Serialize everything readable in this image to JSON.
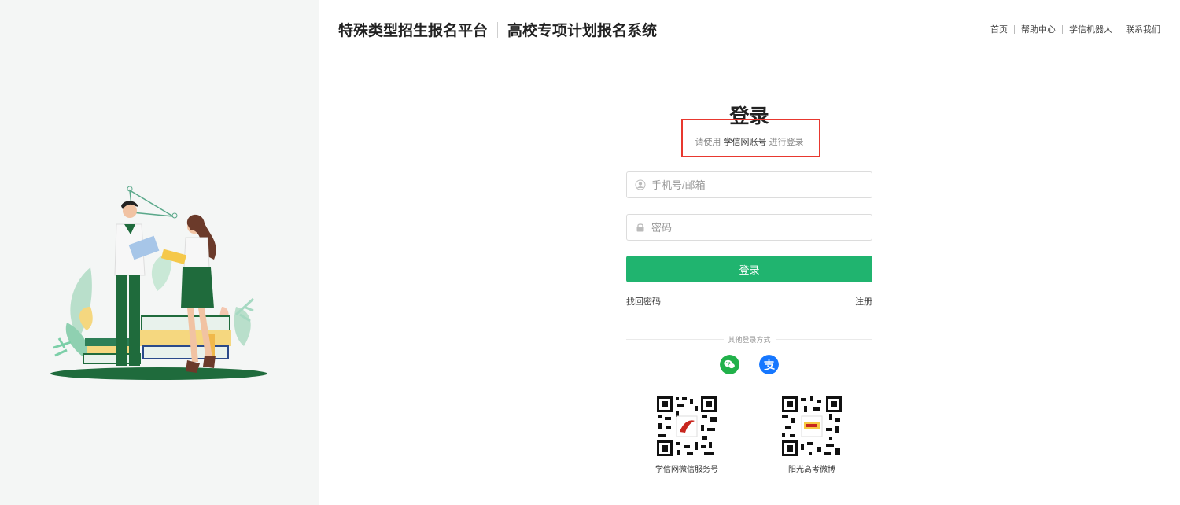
{
  "header": {
    "platform_title": "特殊类型招生报名平台",
    "system_title": "高校专项计划报名系统"
  },
  "topnav": {
    "items": [
      "首页",
      "帮助中心",
      "学信机器人",
      "联系我们"
    ]
  },
  "login": {
    "title": "登录",
    "subtitle_prefix": "请使用",
    "subtitle_account": "学信网账号",
    "subtitle_suffix": "进行登录",
    "username_placeholder": "手机号/邮箱",
    "password_placeholder": "密码",
    "submit_label": "登录",
    "forgot_label": "找回密码",
    "register_label": "注册",
    "other_methods_label": "其他登录方式"
  },
  "social": [
    {
      "icon": "wechat-icon",
      "color": "#21b14a"
    },
    {
      "icon": "alipay-icon",
      "color": "#1677ff"
    }
  ],
  "qrcodes": [
    {
      "label": "学信网微信服务号"
    },
    {
      "label": "阳光高考微博"
    }
  ],
  "colors": {
    "primary": "#20b46f",
    "highlight": "#e8382f",
    "illustration_green": "#1f6b3c"
  }
}
